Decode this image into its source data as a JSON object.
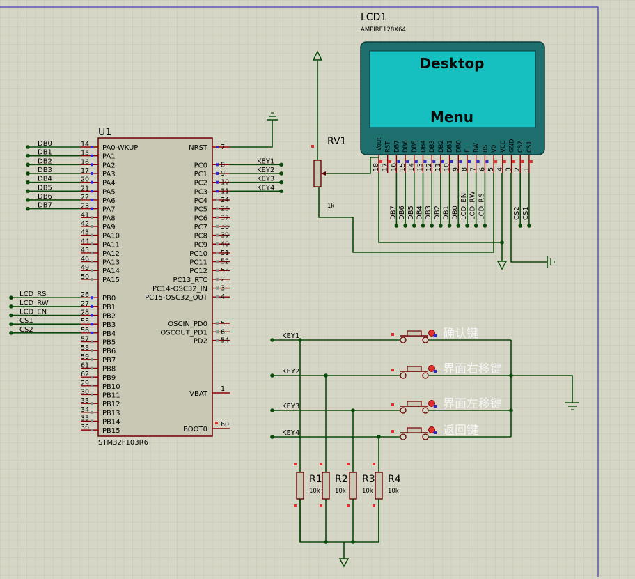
{
  "mcu": {
    "ref": "U1",
    "part": "STM32F103R6",
    "left_pins": [
      {
        "num": "14",
        "name": "PA0-WKUP",
        "net": "DB0"
      },
      {
        "num": "15",
        "name": "PA1",
        "net": "DB1"
      },
      {
        "num": "16",
        "name": "PA2",
        "net": "DB2"
      },
      {
        "num": "17",
        "name": "PA3",
        "net": "DB3"
      },
      {
        "num": "20",
        "name": "PA4",
        "net": "DB4"
      },
      {
        "num": "21",
        "name": "PA5",
        "net": "DB5"
      },
      {
        "num": "22",
        "name": "PA6",
        "net": "DB6"
      },
      {
        "num": "23",
        "name": "PA7",
        "net": "DB7"
      },
      {
        "num": "41",
        "name": "PA8",
        "net": ""
      },
      {
        "num": "42",
        "name": "PA9",
        "net": ""
      },
      {
        "num": "43",
        "name": "PA10",
        "net": ""
      },
      {
        "num": "44",
        "name": "PA11",
        "net": ""
      },
      {
        "num": "45",
        "name": "PA12",
        "net": ""
      },
      {
        "num": "46",
        "name": "PA13",
        "net": ""
      },
      {
        "num": "49",
        "name": "PA14",
        "net": ""
      },
      {
        "num": "50",
        "name": "PA15",
        "net": ""
      },
      {
        "num": "",
        "name": "",
        "net": ""
      },
      {
        "num": "26",
        "name": "PB0",
        "net": "LCD_RS"
      },
      {
        "num": "27",
        "name": "PB1",
        "net": "LCD_RW"
      },
      {
        "num": "28",
        "name": "PB2",
        "net": "LCD_EN"
      },
      {
        "num": "55",
        "name": "PB3",
        "net": "CS1"
      },
      {
        "num": "56",
        "name": "PB4",
        "net": "CS2"
      },
      {
        "num": "57",
        "name": "PB5",
        "net": ""
      },
      {
        "num": "58",
        "name": "PB6",
        "net": ""
      },
      {
        "num": "59",
        "name": "PB7",
        "net": ""
      },
      {
        "num": "61",
        "name": "PB8",
        "net": ""
      },
      {
        "num": "62",
        "name": "PB9",
        "net": ""
      },
      {
        "num": "29",
        "name": "PB10",
        "net": ""
      },
      {
        "num": "30",
        "name": "PB11",
        "net": ""
      },
      {
        "num": "33",
        "name": "PB12",
        "net": ""
      },
      {
        "num": "34",
        "name": "PB13",
        "net": ""
      },
      {
        "num": "35",
        "name": "PB14",
        "net": ""
      },
      {
        "num": "36",
        "name": "PB15",
        "net": ""
      }
    ],
    "right_pins_top": [
      {
        "num": "7",
        "name": "NRST",
        "net": ""
      },
      {
        "num": "",
        "name": "",
        "net": ""
      },
      {
        "num": "8",
        "name": "PC0",
        "net": "KEY1"
      },
      {
        "num": "9",
        "name": "PC1",
        "net": "KEY2"
      },
      {
        "num": "10",
        "name": "PC2",
        "net": "KEY3"
      },
      {
        "num": "11",
        "name": "PC3",
        "net": "KEY4"
      },
      {
        "num": "24",
        "name": "PC4",
        "net": ""
      },
      {
        "num": "25",
        "name": "PC5",
        "net": ""
      },
      {
        "num": "37",
        "name": "PC6",
        "net": ""
      },
      {
        "num": "38",
        "name": "PC7",
        "net": ""
      },
      {
        "num": "39",
        "name": "PC8",
        "net": ""
      },
      {
        "num": "40",
        "name": "PC9",
        "net": ""
      },
      {
        "num": "51",
        "name": "PC10",
        "net": ""
      },
      {
        "num": "52",
        "name": "PC11",
        "net": ""
      },
      {
        "num": "53",
        "name": "PC12",
        "net": ""
      },
      {
        "num": "2",
        "name": "PC13_RTC",
        "net": ""
      },
      {
        "num": "3",
        "name": "PC14-OSC32_IN",
        "net": ""
      },
      {
        "num": "4",
        "name": "PC15-OSC32_OUT",
        "net": ""
      }
    ],
    "right_pins_bottom": [
      {
        "num": "5",
        "name": "OSCIN_PD0"
      },
      {
        "num": "6",
        "name": "OSCOUT_PD1"
      },
      {
        "num": "54",
        "name": "PD2"
      }
    ],
    "vbat": {
      "num": "1",
      "name": "VBAT"
    },
    "boot0": {
      "num": "60",
      "name": "BOOT0"
    }
  },
  "lcd": {
    "ref": "LCD1",
    "part": "AMPIRE128X64",
    "screen_line1": "Desktop",
    "screen_line2": "Menu",
    "pins": [
      {
        "name": "-Vout",
        "num": "18"
      },
      {
        "name": "RST",
        "num": "17"
      },
      {
        "name": "DB7",
        "num": "16"
      },
      {
        "name": "DB6",
        "num": "15"
      },
      {
        "name": "DB5",
        "num": "14"
      },
      {
        "name": "DB4",
        "num": "13"
      },
      {
        "name": "DB3",
        "num": "12"
      },
      {
        "name": "DB2",
        "num": "11"
      },
      {
        "name": "DB1",
        "num": "10"
      },
      {
        "name": "DB0",
        "num": "9"
      },
      {
        "name": "E",
        "num": "8"
      },
      {
        "name": "RW",
        "num": "7"
      },
      {
        "name": "RS",
        "num": "6"
      },
      {
        "name": "V0",
        "num": "5"
      },
      {
        "name": "VCC",
        "num": "4"
      },
      {
        "name": "GND",
        "num": "3"
      },
      {
        "name": "CS2",
        "num": "2"
      },
      {
        "name": "CS1",
        "num": "1"
      }
    ],
    "net_labels": [
      "DB7",
      "DB6",
      "DB5",
      "DB4",
      "DB3",
      "DB2",
      "DB1",
      "DB0",
      "LCD_EN",
      "LCD_RW",
      "LCD_RS",
      "CS2",
      "CS1"
    ]
  },
  "pot": {
    "ref": "RV1",
    "value": "1k"
  },
  "keys": [
    {
      "net": "KEY1",
      "label": "确认键"
    },
    {
      "net": "KEY2",
      "label": "界面右移键"
    },
    {
      "net": "KEY3",
      "label": "界面左移键"
    },
    {
      "net": "KEY4",
      "label": "返回键"
    }
  ],
  "resistors": [
    {
      "ref": "R1",
      "value": "10k"
    },
    {
      "ref": "R2",
      "value": "10k"
    },
    {
      "ref": "R3",
      "value": "10k"
    },
    {
      "ref": "R4",
      "value": "10k"
    }
  ],
  "colors": {
    "background": "#d6d6c6",
    "grid": "#c3c3b2",
    "wire": "#0a4a0a",
    "pin": "#8b0000",
    "chip_fill": "#c8c8b4",
    "lcd_frame": "#1f6f6f",
    "lcd_screen": "#17c0c0",
    "border": "#1a1aa8"
  }
}
